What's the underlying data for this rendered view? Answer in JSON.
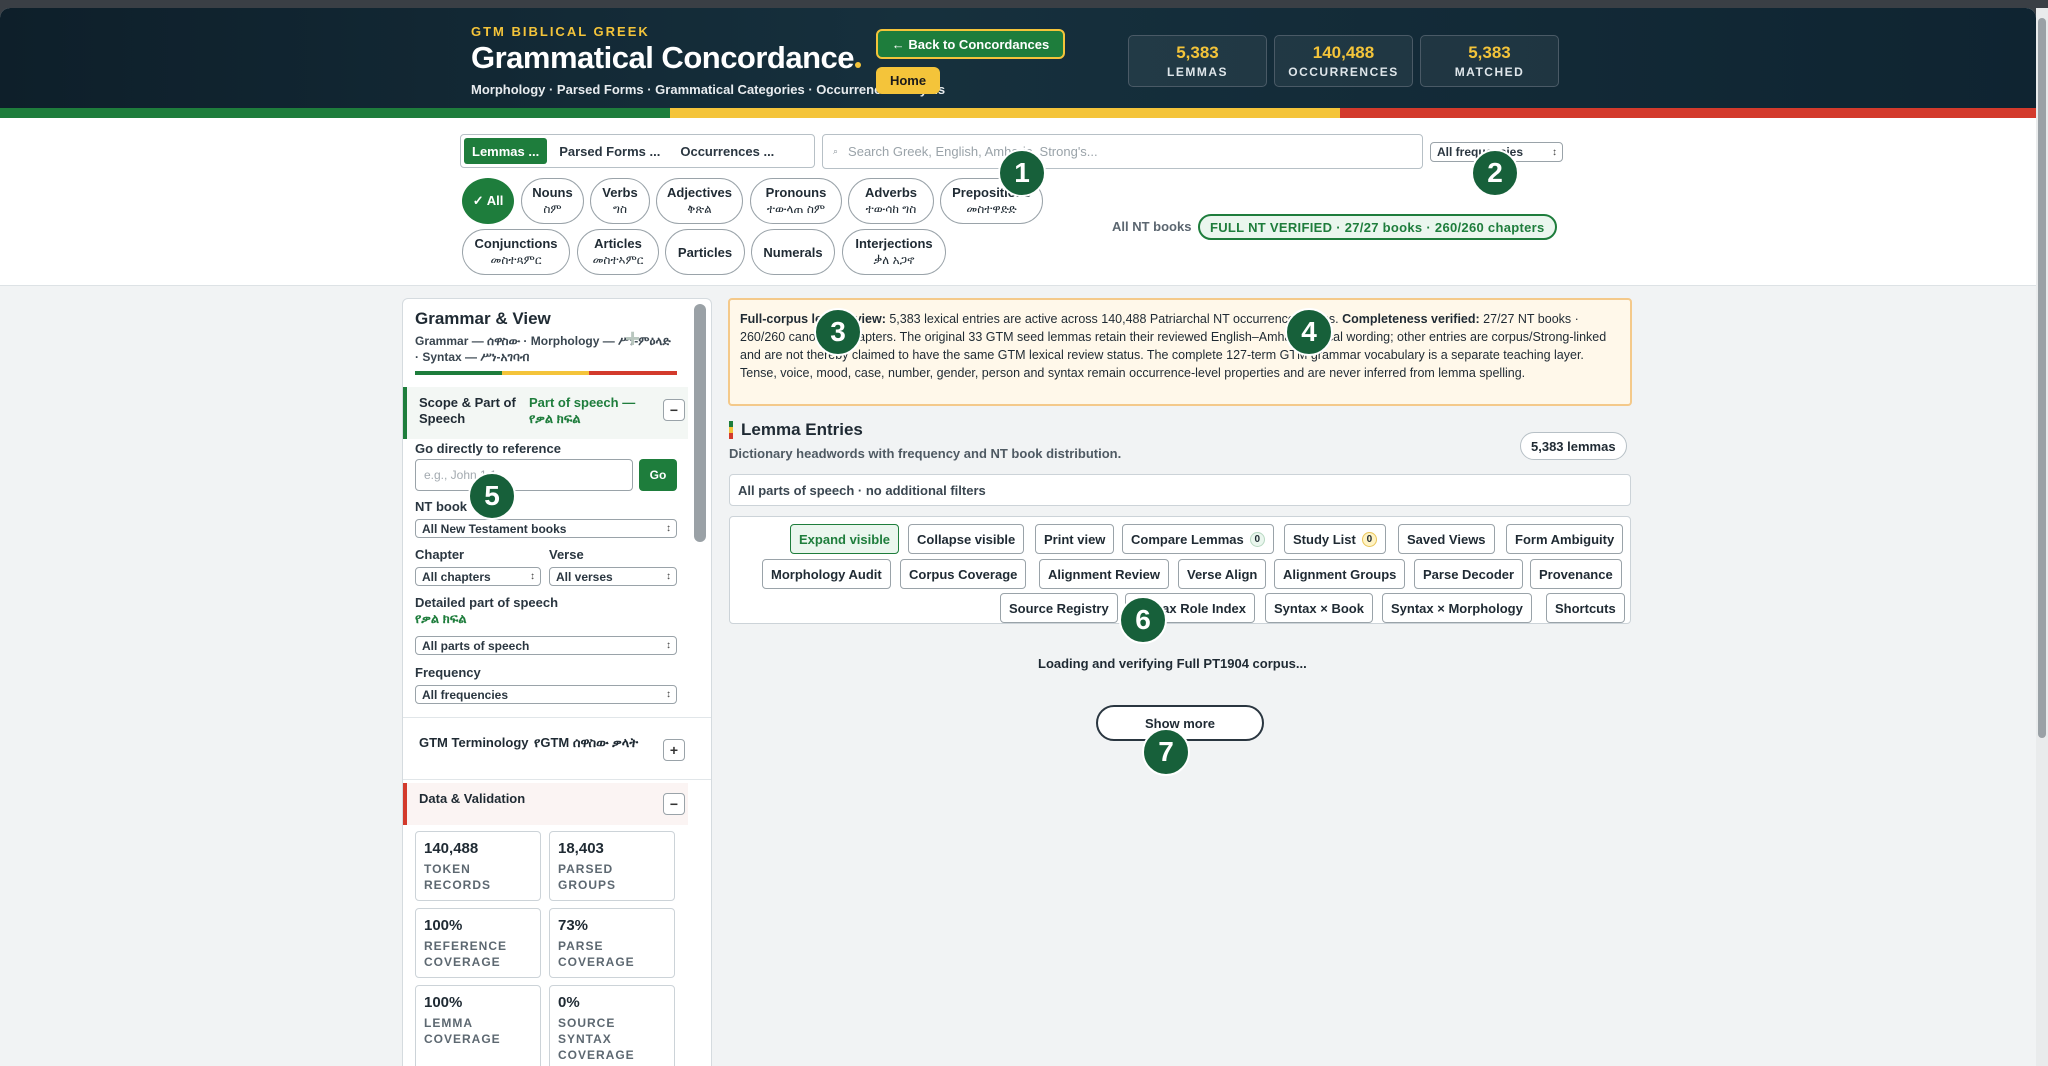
{
  "brand": {
    "small": "GTM BIBLICAL GREEK",
    "title": "Grammatical Concordance",
    "subtitle": "Morphology · Parsed Forms · Grammatical Categories · Occurrence Analysis"
  },
  "header_buttons": {
    "back": "← Back to Concordances",
    "home": "Home"
  },
  "stats": [
    {
      "value": "5,383",
      "label": "LEMMAS"
    },
    {
      "value": "140,488",
      "label": "OCCURRENCES"
    },
    {
      "value": "5,383",
      "label": "MATCHED"
    }
  ],
  "view_tabs": [
    "Lemmas ...",
    "Parsed Forms ...",
    "Occurrences ..."
  ],
  "search": {
    "placeholder": "Search Greek, English, Amharic, Strong's..."
  },
  "frequency_select": "All frequencies",
  "pos_chips": [
    {
      "en": "✓ All",
      "am": ""
    },
    {
      "en": "Nouns",
      "am": "ስም"
    },
    {
      "en": "Verbs",
      "am": "ግስ"
    },
    {
      "en": "Adjectives",
      "am": "ቅጽል"
    },
    {
      "en": "Pronouns",
      "am": "ተውላጠ ስም"
    },
    {
      "en": "Adverbs",
      "am": "ተውሳከ ግስ"
    },
    {
      "en": "Prepositions",
      "am": "መስተዋድድ"
    },
    {
      "en": "Conjunctions",
      "am": "መስተጻምር"
    },
    {
      "en": "Articles",
      "am": "መስተኣምር"
    },
    {
      "en": "Particles",
      "am": ""
    },
    {
      "en": "Numerals",
      "am": ""
    },
    {
      "en": "Interjections",
      "am": "ቃለ አጋኖ"
    }
  ],
  "books_label": "All NT books",
  "verified_badge": "FULL NT VERIFIED · 27/27 books · 260/260 chapters",
  "markers": [
    "1",
    "2",
    "3",
    "4",
    "5",
    "6",
    "7"
  ],
  "sidebar": {
    "title": "Grammar & View",
    "subtitle": "Grammar — ሰዋስው · Morphology — ሥነ-ምዕላድ · Syntax — ሥነ-አገባብ",
    "scope": {
      "title": "Scope & Part of Speech",
      "amharic": "Part of speech — የቃል ክፍል",
      "toggle": "−"
    },
    "goto_label": "Go directly to reference",
    "ref_placeholder": "e.g., John 1:1",
    "go": "Go",
    "nt_book_label": "NT book",
    "nt_book_value": "All New Testament books",
    "chapter_label": "Chapter",
    "chapter_value": "All chapters",
    "verse_label": "Verse",
    "verse_value": "All verses",
    "detailed_pos_label": "Detailed part of speech",
    "detailed_pos_am": "የቃል ክፍል",
    "detailed_pos_value": "All parts of speech",
    "frequency_label": "Frequency",
    "frequency_value": "All frequencies",
    "terminology": {
      "title": "GTM Terminology",
      "amharic": "የGTM ሰዋስው ቃላት",
      "toggle": "+"
    },
    "validation": {
      "title": "Data & Validation",
      "toggle": "−"
    },
    "metrics": [
      {
        "value": "140,488",
        "label": "TOKEN RECORDS"
      },
      {
        "value": "18,403",
        "label": "PARSED GROUPS"
      },
      {
        "value": "100%",
        "label": "REFERENCE COVERAGE"
      },
      {
        "value": "73%",
        "label": "PARSE COVERAGE"
      },
      {
        "value": "100%",
        "label": "LEMMA COVERAGE"
      },
      {
        "value": "0%",
        "label": "SOURCE SYNTAX COVERAGE"
      }
    ]
  },
  "notice": {
    "lead": "Full-corpus lemma view:",
    "part1": " 5,383 lexical entries are active across 140,488 Patriarchal NT occurrence tokens. ",
    "bold2": "Completeness verified:",
    "part2": " 27/27 NT books · 260/260 canonical chapters. The original 33 GTM seed lemmas retain their reviewed English–Amharic lexical wording; other entries are corpus/Strong-linked and are not thereby claimed to have the same GTM lexical review status. The complete 127-term GTM grammar vocabulary is a separate teaching layer. Tense, voice, mood, case, number, gender, person and syntax remain occurrence-level properties and are never inferred from lemma spelling."
  },
  "lemma_entries": {
    "title": "Lemma Entries",
    "subtitle": "Dictionary headwords with frequency and NT book distribution.",
    "count": "5,383 lemmas",
    "filters": "All parts of speech · no additional filters"
  },
  "actions": {
    "expand": "Expand visible",
    "collapse": "Collapse visible",
    "print": "Print view",
    "compare": "Compare Lemmas",
    "compare_count": "0",
    "study": "Study List",
    "study_count": "0",
    "saved": "Saved Views",
    "ambiguity": "Form Ambiguity",
    "morph_audit": "Morphology Audit",
    "corpus_cov": "Corpus Coverage",
    "align_review": "Alignment Review",
    "verse_align": "Verse Align",
    "align_groups": "Alignment Groups",
    "parse_decoder": "Parse Decoder",
    "provenance": "Provenance",
    "source_registry": "Source Registry",
    "syntax_role": "Syntax Role Index",
    "syntax_book": "Syntax × Book",
    "syntax_morph": "Syntax × Morphology",
    "shortcuts": "Shortcuts"
  },
  "loading": "Loading and verifying Full PT1904 corpus...",
  "show_more": "Show more",
  "colors": {
    "green": "#1e7d3c",
    "gold": "#f4c43a",
    "red": "#d33a2c",
    "header": "#0e1f2a"
  }
}
